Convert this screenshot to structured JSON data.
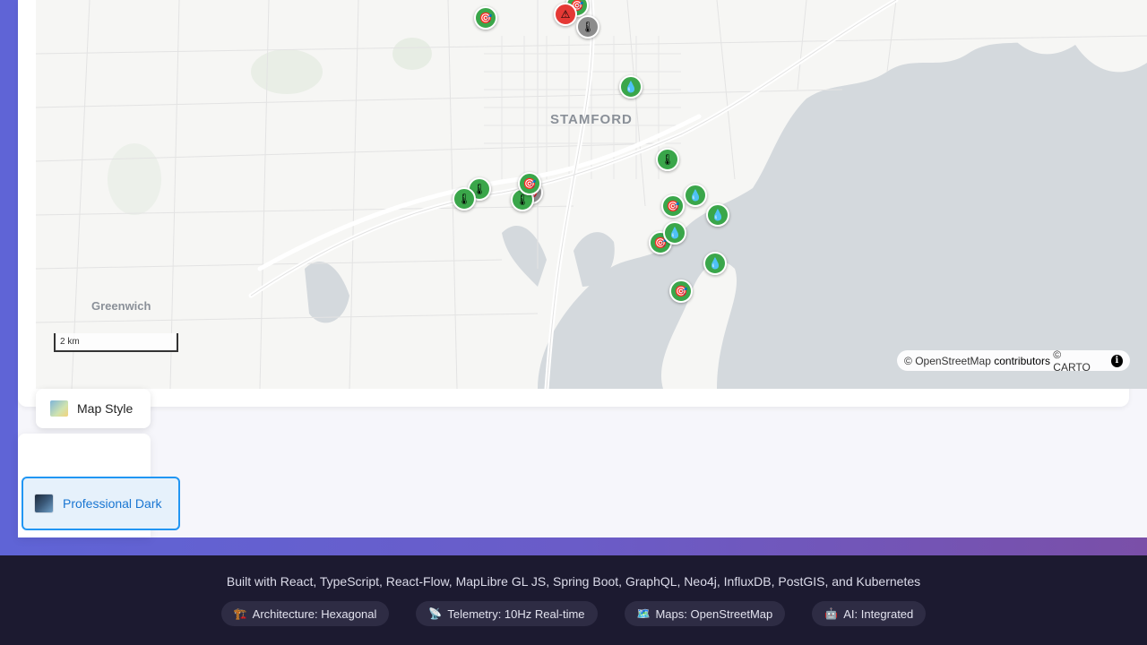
{
  "map": {
    "city_label": "STAMFORD",
    "town_label": "Greenwich",
    "scale_label": "2 km",
    "attribution": {
      "prefix": "©",
      "osm_link": "OpenStreetMap",
      "contributors": "contributors",
      "carto": "© CARTO",
      "info_icon": "info-icon"
    },
    "markers": [
      {
        "type": "sensor",
        "icon": "target-icon",
        "color": "green"
      },
      {
        "type": "sensor",
        "icon": "target-icon",
        "color": "green"
      },
      {
        "type": "alert",
        "icon": "warning-icon",
        "color": "red"
      },
      {
        "type": "sensor",
        "icon": "thermometer-icon",
        "color": "gray"
      },
      {
        "type": "sensor",
        "icon": "water-drop-icon",
        "color": "green"
      },
      {
        "type": "sensor",
        "icon": "thermometer-icon",
        "color": "green"
      },
      {
        "type": "sensor",
        "icon": "thermometer-icon",
        "color": "green"
      },
      {
        "type": "sensor",
        "icon": "thermometer-icon",
        "color": "green"
      },
      {
        "type": "sensor",
        "icon": "target-icon",
        "color": "green"
      },
      {
        "type": "sensor",
        "icon": "thermometer-icon",
        "color": "green"
      },
      {
        "type": "sensor",
        "icon": "target-icon",
        "color": "green"
      },
      {
        "type": "sensor",
        "icon": "water-drop-icon",
        "color": "green"
      },
      {
        "type": "sensor",
        "icon": "water-drop-icon",
        "color": "green"
      },
      {
        "type": "sensor",
        "icon": "target-icon",
        "color": "green"
      },
      {
        "type": "sensor",
        "icon": "water-drop-icon",
        "color": "green"
      },
      {
        "type": "sensor",
        "icon": "water-drop-icon",
        "color": "green"
      },
      {
        "type": "sensor",
        "icon": "target-icon",
        "color": "green"
      }
    ]
  },
  "controls": {
    "map_style_label": "Map Style",
    "map_style_icon": "map-icon",
    "selected_style": "Professional Dark"
  },
  "footer": {
    "built_with": "Built with React, TypeScript, React-Flow, MapLibre GL JS, Spring Boot, GraphQL, Neo4j, InfluxDB, PostGIS, and Kubernetes",
    "badges": [
      {
        "icon": "🏗️",
        "label": "Architecture: Hexagonal"
      },
      {
        "icon": "📡",
        "label": "Telemetry: 10Hz Real-time"
      },
      {
        "icon": "🗺️",
        "label": "Maps: OpenStreetMap"
      },
      {
        "icon": "🤖",
        "label": "AI: Integrated"
      }
    ]
  },
  "colors": {
    "accent": "#2196f3",
    "marker_green": "#3aa64a",
    "marker_red": "#e53935",
    "marker_gray": "#8c8c8c",
    "footer_bg": "#1c1a30",
    "water": "#d4d9dd"
  }
}
